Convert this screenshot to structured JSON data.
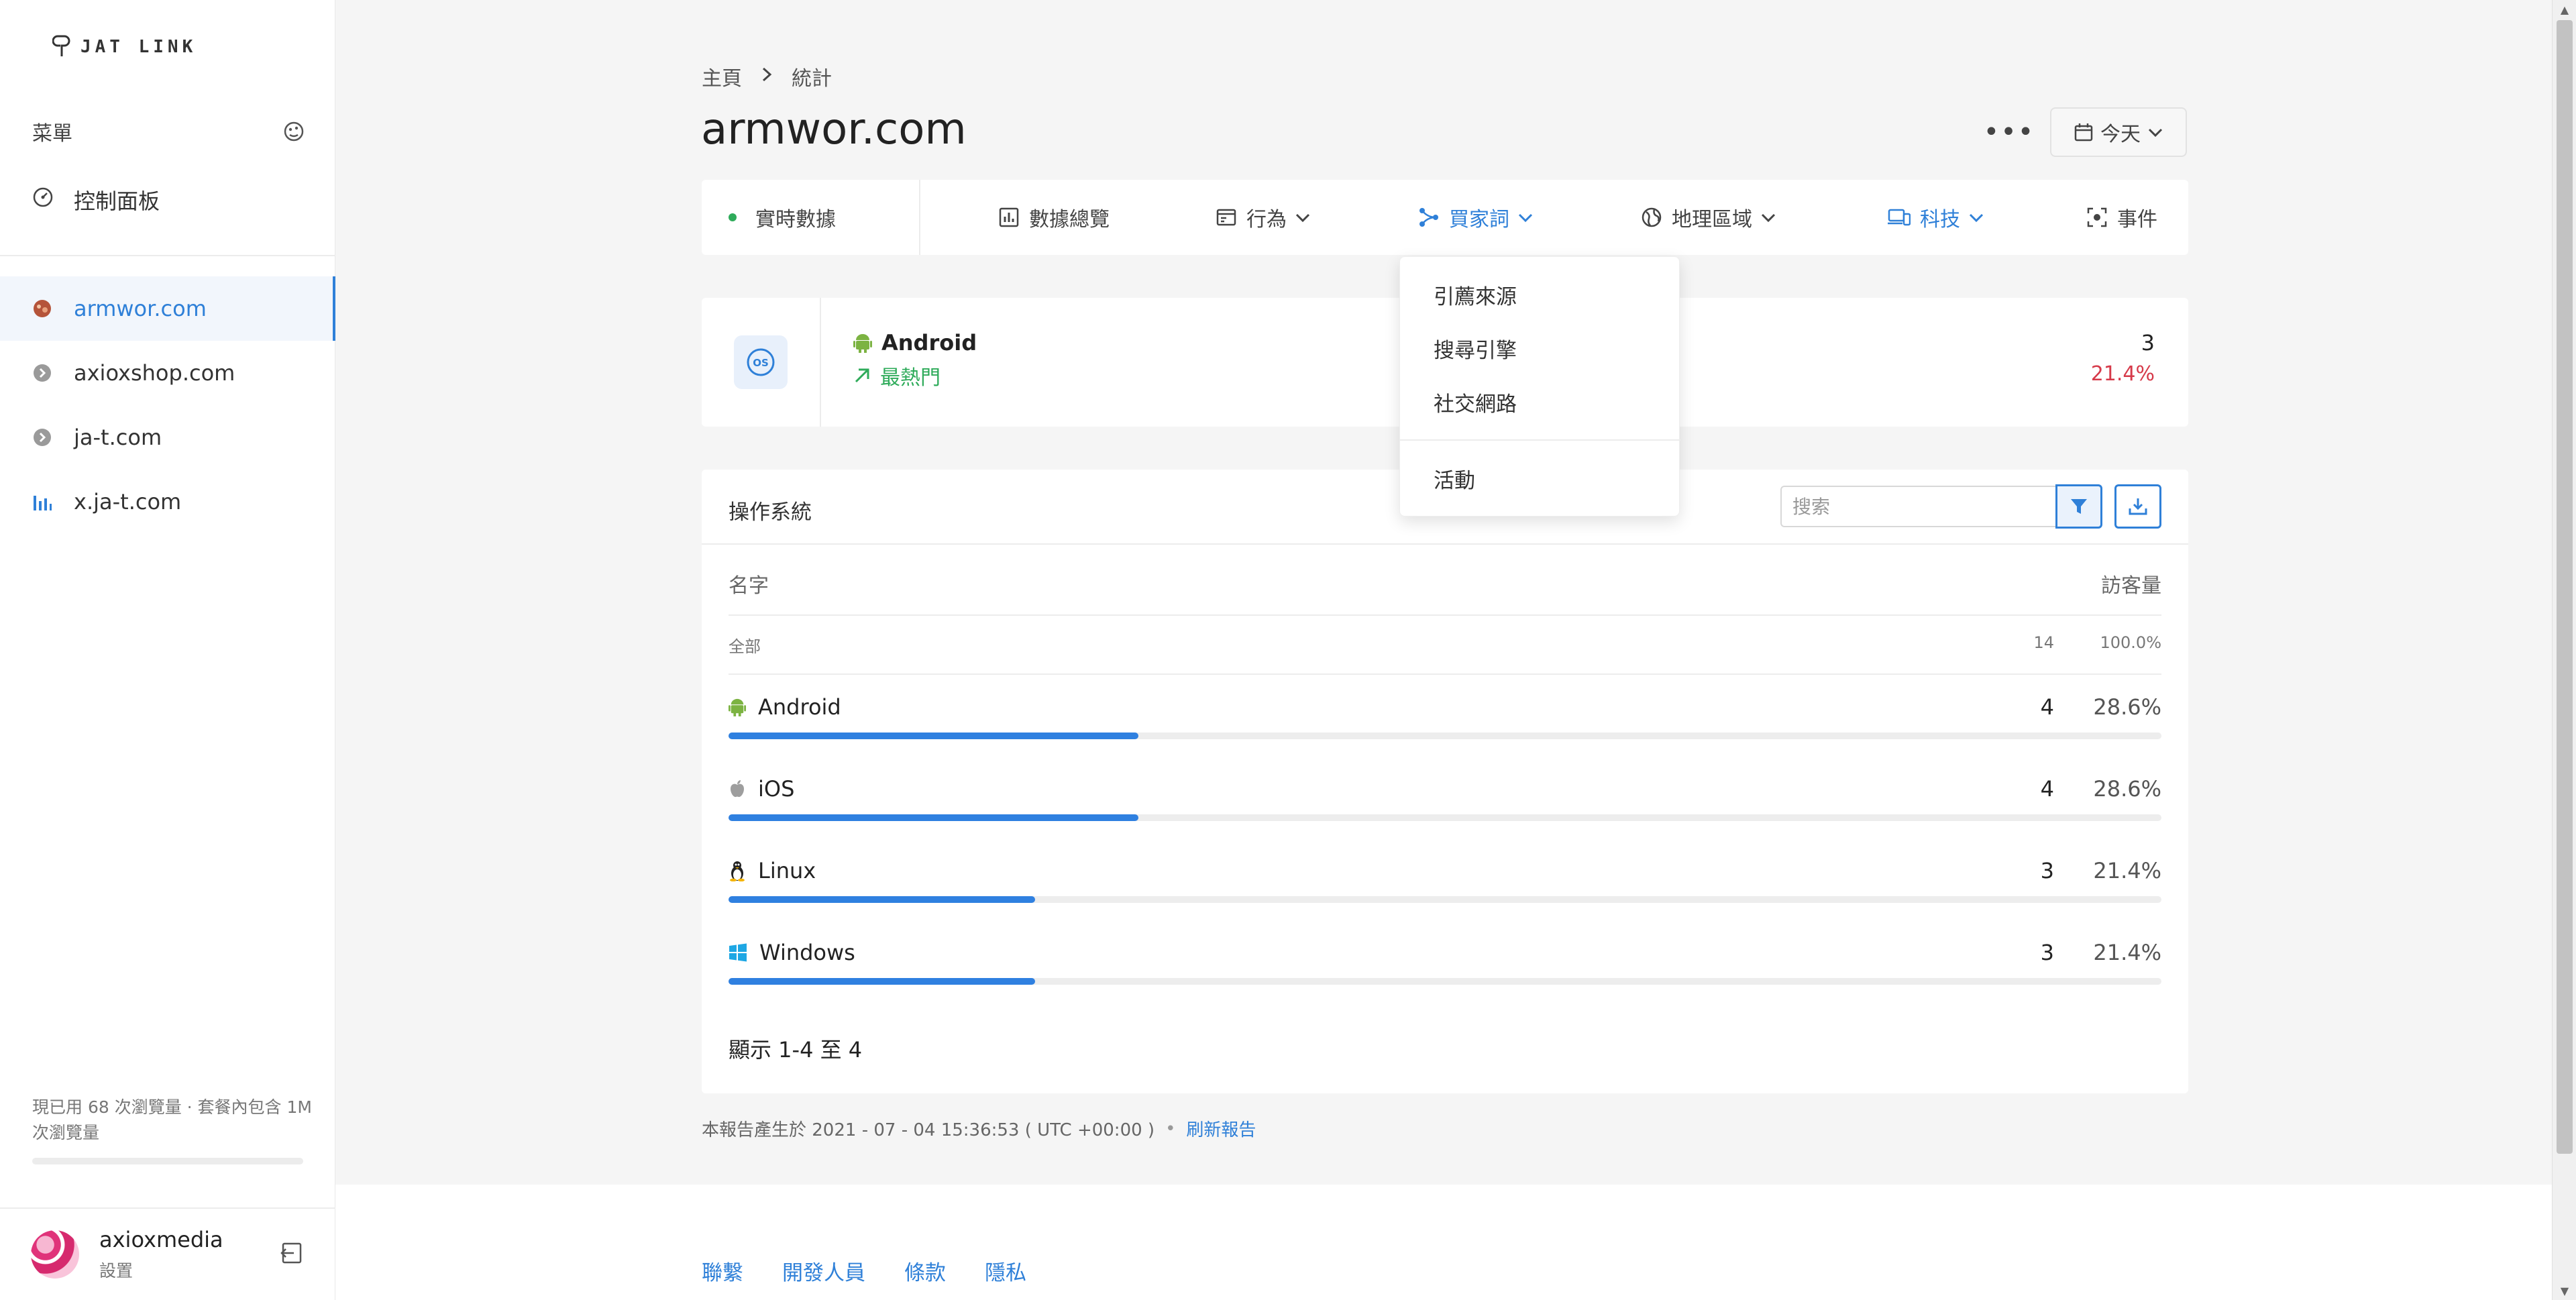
{
  "app": {
    "logo_text": "JAT LINK"
  },
  "sidebar": {
    "menu_label": "菜單",
    "dashboard_label": "控制面板",
    "sites": [
      {
        "label": "armwor.com"
      },
      {
        "label": "axioxshop.com"
      },
      {
        "label": "ja-t.com"
      },
      {
        "label": "x.ja-t.com"
      }
    ],
    "usage_text": "現已用 68 次瀏覽量 · 套餐內包含 1M 次瀏覽量",
    "usage_progress": 0.0001,
    "user": {
      "name": "axioxmedia",
      "sub": "設置"
    }
  },
  "breadcrumb": {
    "home": "主頁",
    "current": "統計"
  },
  "page": {
    "title": "armwor.com",
    "more": "•••",
    "date_label": "今天"
  },
  "tabs": {
    "realtime": "實時數據",
    "overview": "數據總覽",
    "behavior": "行為",
    "acquisition": "買家詞",
    "geo": "地理區域",
    "tech": "科技",
    "events": "事件"
  },
  "dropdown": {
    "items": [
      "引薦來源",
      "搜尋引擎",
      "社交網路",
      "活動"
    ]
  },
  "summary": {
    "name": "Android",
    "trend": "最熱門",
    "count": "3",
    "percent": "21.4%"
  },
  "table": {
    "title": "操作系統",
    "search_placeholder": "搜索",
    "col_name": "名字",
    "col_visitors": "訪客量",
    "all_label": "全部",
    "all_count": "14",
    "all_percent": "100.0%",
    "rows": [
      {
        "name": "Android",
        "icon": "android-icon",
        "count": "4",
        "percent": "28.6%",
        "fraction": 0.286
      },
      {
        "name": "iOS",
        "icon": "apple-icon",
        "count": "4",
        "percent": "28.6%",
        "fraction": 0.286
      },
      {
        "name": "Linux",
        "icon": "linux-icon",
        "count": "3",
        "percent": "21.4%",
        "fraction": 0.214
      },
      {
        "name": "Windows",
        "icon": "windows-icon",
        "count": "3",
        "percent": "21.4%",
        "fraction": 0.214
      }
    ],
    "showing": "顯示 1-4 至 4"
  },
  "report": {
    "text": "本報告產生於 2021 - 07 - 04 15:36:53 ( UTC +00:00 )",
    "refresh": "刷新報告"
  },
  "footer": {
    "links": [
      "聯繫",
      "開發人員",
      "條款",
      "隱私"
    ]
  },
  "colors": {
    "accent": "#2f80d8",
    "positive": "#2eab5a",
    "negative": "#d63a4a",
    "android": "#7cb342",
    "windows": "#1ea7e4"
  }
}
